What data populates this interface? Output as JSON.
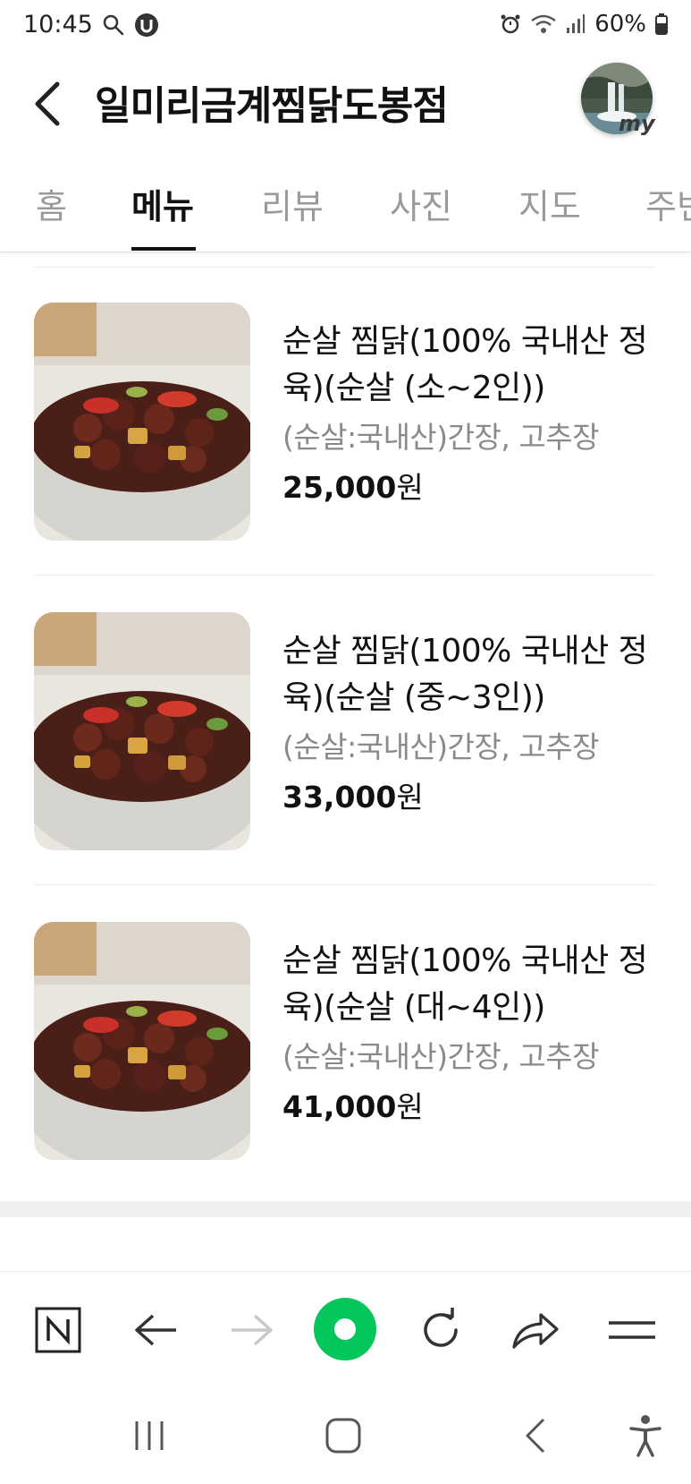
{
  "status_bar": {
    "time": "10:45",
    "battery": "60%",
    "icons": [
      "search-icon",
      "u-badge-icon",
      "alarm-icon",
      "wifi-icon",
      "signal-icon",
      "battery-icon"
    ]
  },
  "header": {
    "title": "일미리금계찜닭도봉점",
    "avatar_badge": "my"
  },
  "tabs": [
    {
      "label": "홈",
      "active": false
    },
    {
      "label": "메뉴",
      "active": true
    },
    {
      "label": "리뷰",
      "active": false
    },
    {
      "label": "사진",
      "active": false
    },
    {
      "label": "지도",
      "active": false
    },
    {
      "label": "주변",
      "active": false
    }
  ],
  "menu": {
    "items": [
      {
        "name": "순살 찜닭(100% 국내산 정육)(순살 (소~2인))",
        "desc": "(순살:국내산)간장, 고추장",
        "price_num": "25,000",
        "price_unit": "원"
      },
      {
        "name": "순살 찜닭(100% 국내산 정육)(순살 (중~3인))",
        "desc": "(순살:국내산)간장, 고추장",
        "price_num": "33,000",
        "price_unit": "원"
      },
      {
        "name": "순살 찜닭(100% 국내산 정육)(순살 (대~4인))",
        "desc": "(순살:국내산)간장, 고추장",
        "price_num": "41,000",
        "price_unit": "원"
      }
    ]
  },
  "browser_toolbar": {
    "buttons": [
      "naver-home-icon",
      "back-arrow-icon",
      "forward-arrow-icon",
      "green-dot-icon",
      "reload-icon",
      "share-icon",
      "menu-icon"
    ]
  },
  "system_nav": {
    "buttons": [
      "recent-apps-icon",
      "home-icon",
      "back-icon",
      "accessibility-icon"
    ]
  },
  "colors": {
    "accent_green": "#03c75a",
    "text_primary": "#111111",
    "text_secondary": "#8a8a8a",
    "tab_inactive": "#9a9a9a"
  }
}
